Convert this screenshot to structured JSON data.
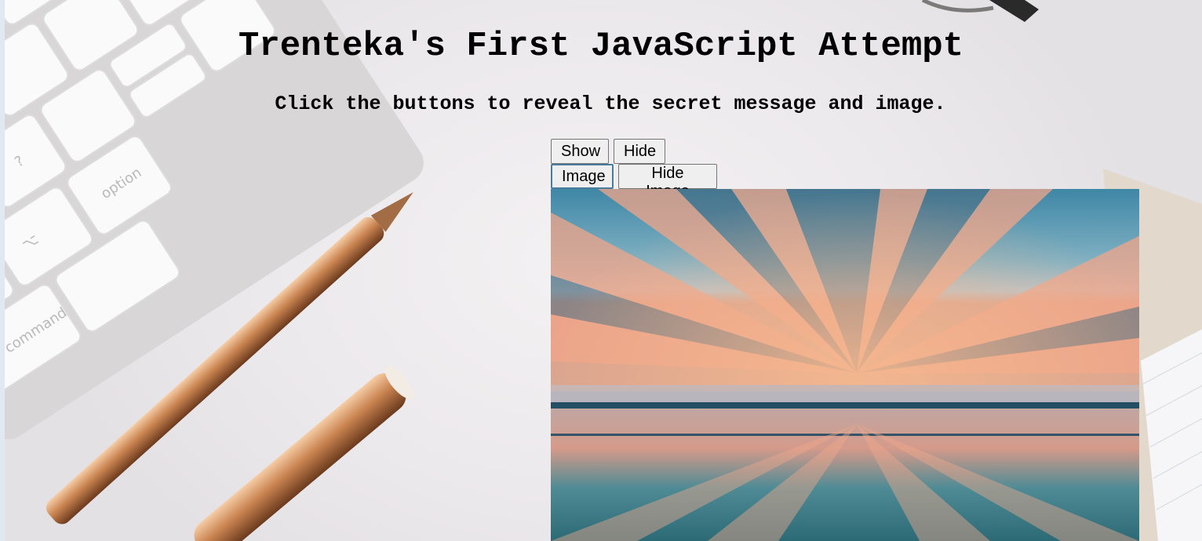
{
  "page": {
    "title": "Trenteka's First JavaScript Attempt",
    "subtitle": "Click the buttons to reveal the secret message and image."
  },
  "buttons": {
    "show_label": "Show",
    "hide_label": "Hide",
    "image_label": "Image",
    "hide_image_label": "Hide Image"
  },
  "colors": {
    "background": "#ece9ec",
    "button_bg": "#efefef",
    "focus_border": "#4a7d9b"
  }
}
